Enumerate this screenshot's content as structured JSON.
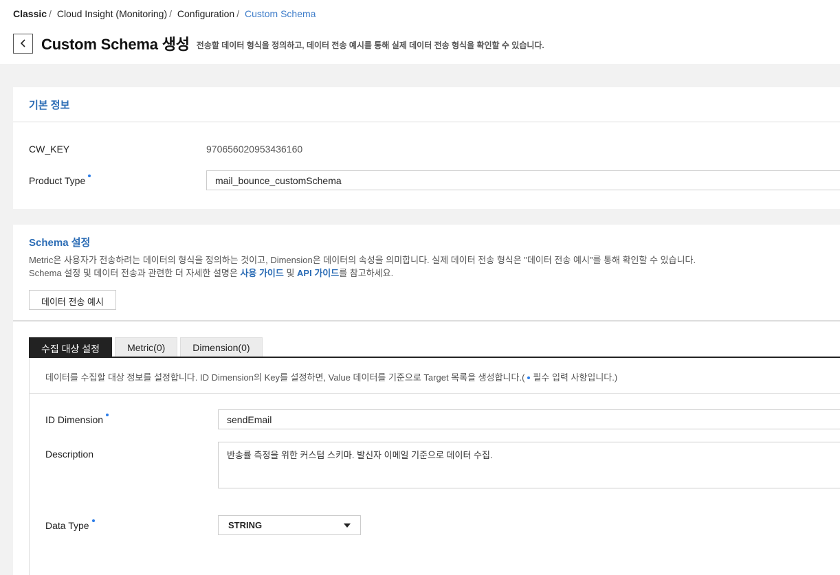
{
  "breadcrumb": {
    "root": "Classic",
    "items": [
      "Cloud Insight (Monitoring)",
      "Configuration"
    ],
    "current": "Custom Schema",
    "separator": "/"
  },
  "header": {
    "title": "Custom Schema 생성",
    "description": "전송할 데이터 형식을 정의하고, 데이터 전송 예시를 통해 실제 데이터 전송 형식을 확인할 수 있습니다."
  },
  "basic_info": {
    "title": "기본 정보",
    "cw_key_label": "CW_KEY",
    "cw_key_value": "970656020953436160",
    "product_type_label": "Product Type",
    "product_type_value": "mail_bounce_customSchema"
  },
  "schema": {
    "title": "Schema 설정",
    "desc_line1": "Metric은 사용자가 전송하려는 데이터의 형식을 정의하는 것이고, Dimension은 데이터의 속성을 의미합니다. 실제 데이터 전송 형식은 \"데이터 전송 예시\"를 통해 확인할 수 있습니다.",
    "desc_line2_pre": "Schema 설정 및 데이터 전송과 관련한 더 자세한 설명은 ",
    "usage_guide": "사용 가이드",
    "and": " 및 ",
    "api_guide": "API 가이드",
    "desc_line2_post": "를 참고하세요.",
    "example_button": "데이터 전송 예시"
  },
  "tabs": [
    {
      "label": "수집 대상 설정",
      "active": true
    },
    {
      "label": "Metric(0)",
      "active": false
    },
    {
      "label": "Dimension(0)",
      "active": false
    }
  ],
  "panel": {
    "desc_pre": "데이터를 수집할 대상 정보를 설정합니다. ID Dimension의 Key를 설정하면, Value 데이터를 기준으로 Target 목록을 생성합니다.(",
    "desc_post": "필수 입력 사항입니다.)",
    "id_dimension_label": "ID Dimension",
    "id_dimension_value": "sendEmail",
    "description_label": "Description",
    "description_value": "반송률 측정을 위한 커스텀 스키마. 발신자 이메일 기준으로 데이터 수집.",
    "data_type_label": "Data Type",
    "data_type_value": "STRING"
  },
  "colors": {
    "accent": "#2b6cb5",
    "link": "#3d7cc9",
    "required_dot": "#2b7de9",
    "active_tab": "#222222"
  }
}
